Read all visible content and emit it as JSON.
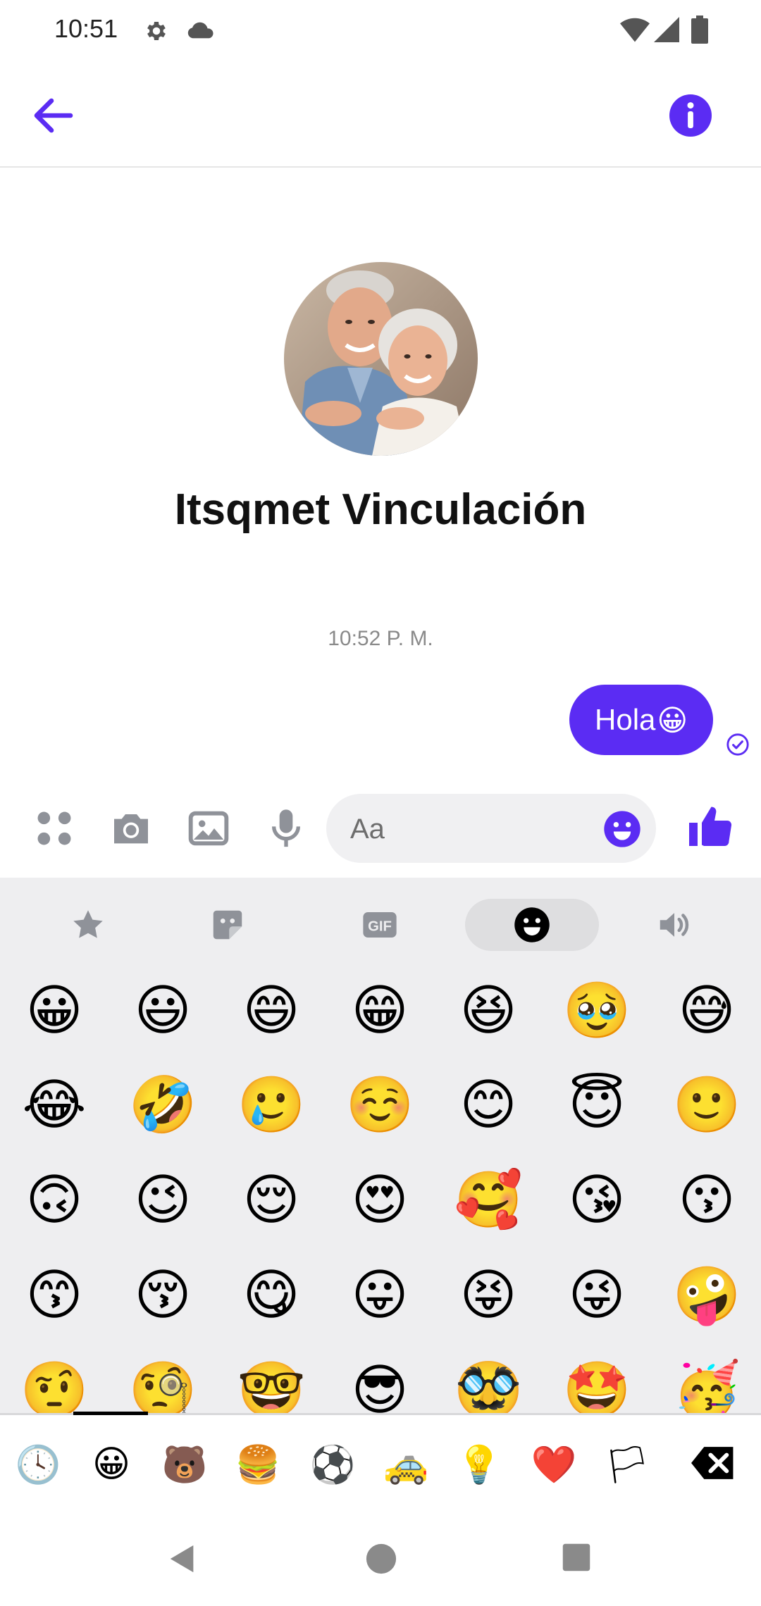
{
  "status_bar": {
    "time": "10:51"
  },
  "contact": {
    "name": "Itsqmet Vinculación"
  },
  "conversation": {
    "timestamp": "10:52 P. M.",
    "messages": [
      {
        "text": "Hola",
        "emoji": "😀",
        "sender": "me"
      }
    ]
  },
  "composer": {
    "placeholder": "Aa"
  },
  "emoji_panel": {
    "tabs": [
      "favorites-icon",
      "stickers-icon",
      "gif-icon",
      "emoji-icon",
      "sound-icon"
    ],
    "active_tab": "emoji-icon",
    "gif_label": "GIF",
    "emojis": [
      "😀",
      "😃",
      "😄",
      "😁",
      "😆",
      "🥹",
      "😅",
      "😂",
      "🤣",
      "🥲",
      "☺️",
      "😊",
      "😇",
      "🙂",
      "🙃",
      "😉",
      "😌",
      "😍",
      "🥰",
      "😘",
      "😗",
      "😙",
      "😚",
      "😋",
      "😛",
      "😝",
      "😜",
      "🤪",
      "🤨",
      "🧐",
      "🤓",
      "😎",
      "🥸",
      "🤩",
      "🥳"
    ],
    "categories": [
      {
        "name": "recent",
        "glyph": "🕓"
      },
      {
        "name": "smileys",
        "glyph": "😀"
      },
      {
        "name": "animals",
        "glyph": "🐻"
      },
      {
        "name": "food",
        "glyph": "🍔"
      },
      {
        "name": "activities",
        "glyph": "⚽"
      },
      {
        "name": "travel",
        "glyph": "🚕"
      },
      {
        "name": "objects",
        "glyph": "💡"
      },
      {
        "name": "symbols",
        "glyph": "❤️"
      },
      {
        "name": "flags",
        "glyph": "🏳"
      }
    ],
    "active_category": "recent"
  },
  "colors": {
    "accent": "#5b2cf3",
    "panel_background": "#eeeef0",
    "icon_gray": "#8f9299"
  }
}
